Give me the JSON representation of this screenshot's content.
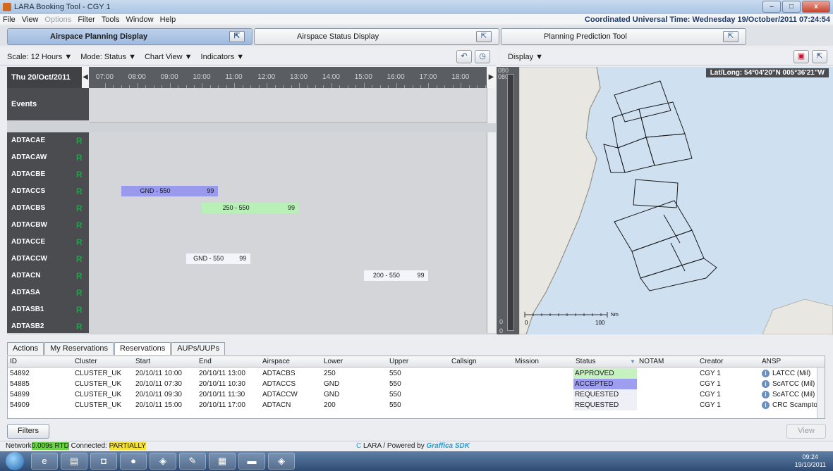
{
  "window": {
    "title": "LARA Booking Tool - CGY 1",
    "minimize": "–",
    "maximize": "□",
    "close": "x"
  },
  "menu": {
    "items": [
      {
        "label": "File",
        "disabled": false
      },
      {
        "label": "View",
        "disabled": false
      },
      {
        "label": "Options",
        "disabled": true
      },
      {
        "label": "Filter",
        "disabled": false
      },
      {
        "label": "Tools",
        "disabled": false
      },
      {
        "label": "Window",
        "disabled": false
      },
      {
        "label": "Help",
        "disabled": false
      }
    ],
    "utc_text": "Coordinated Universal Time: Wednesday 19/October/2011  07:24:54"
  },
  "tabs": [
    {
      "label": "Airspace Planning Display",
      "active": true
    },
    {
      "label": "Airspace Status Display",
      "active": false
    },
    {
      "label": "Planning Prediction Tool",
      "active": false
    }
  ],
  "tab_button_glyph": "⇱",
  "toolbar": {
    "scale": "Scale: 12 Hours ▼",
    "mode": "Mode: Status ▼",
    "chart_view": "Chart View ▼",
    "indicators": "Indicators ▼",
    "display": "Display ▼",
    "undo_glyph": "↶",
    "clock_glyph": "◷",
    "flag_glyph": "▣",
    "detach_glyph": "⇱"
  },
  "timeline": {
    "date": "Thu 20/Oct/2011",
    "left_arrow": "◀",
    "right_arrow": "▶",
    "hours": [
      "07:00",
      "08:00",
      "09:00",
      "10:00",
      "11:00",
      "12:00",
      "13:00",
      "14:00",
      "15:00",
      "16:00",
      "17:00",
      "18:00"
    ],
    "start_hour": 6.5,
    "end_hour": 18.8,
    "events_label": "Events",
    "rows": [
      {
        "name": "ADTACAE",
        "status": "R"
      },
      {
        "name": "ADTACAW",
        "status": "R"
      },
      {
        "name": "ADTACBE",
        "status": "R"
      },
      {
        "name": "ADTACCS",
        "status": "R",
        "bar": {
          "start": 7.5,
          "end": 10.5,
          "text": "GND - 550",
          "num": "99",
          "color": "#9999ee"
        }
      },
      {
        "name": "ADTACBS",
        "status": "R",
        "bar": {
          "start": 10.0,
          "end": 13.0,
          "text": "250 - 550",
          "num": "99",
          "color": "#b8f0b8"
        }
      },
      {
        "name": "ADTACBW",
        "status": "R"
      },
      {
        "name": "ADTACCE",
        "status": "R"
      },
      {
        "name": "ADTACCW",
        "status": "R",
        "bar": {
          "start": 9.5,
          "end": 11.5,
          "text": "GND - 550",
          "num": "99",
          "color": "#f4f4fb"
        }
      },
      {
        "name": "ADTACN",
        "status": "R",
        "bar": {
          "start": 15.0,
          "end": 17.0,
          "text": "200 - 550",
          "num": "99",
          "color": "#f4f4fb"
        }
      },
      {
        "name": "ADTASA",
        "status": "R"
      },
      {
        "name": "ADTASB1",
        "status": "R"
      },
      {
        "name": "ADTASB2",
        "status": "R"
      }
    ]
  },
  "levels": {
    "top1": "080",
    "top2": "080",
    "bottom1": "0",
    "bottom2": "0"
  },
  "map": {
    "latlong": "Lat/Long:  54°04'20\"N 005°36'21\"W",
    "scale_start": "0",
    "scale_end": "100",
    "scale_unit": "Nm"
  },
  "lower_tabs": [
    {
      "label": "Actions",
      "active": false
    },
    {
      "label": "My Reservations",
      "active": false
    },
    {
      "label": "Reservations",
      "active": true
    },
    {
      "label": "AUPs/UUPs",
      "active": false
    }
  ],
  "grid": {
    "columns": [
      "ID",
      "Cluster",
      "Start",
      "End",
      "Airspace",
      "Lower",
      "Upper",
      "Callsign",
      "Mission",
      "Status",
      "NOTAM",
      "Creator",
      "ANSP"
    ],
    "sort_glyph": "▼",
    "rows": [
      {
        "id": "54892",
        "cluster": "CLUSTER_UK",
        "start": "20/10/11 10:00",
        "end": "20/10/11 13:00",
        "airspace": "ADTACBS",
        "lower": "250",
        "upper": "550",
        "callsign": "",
        "mission": "",
        "status": "APPROVED",
        "status_color": "#c6f2c0",
        "notam": "",
        "creator": "CGY 1",
        "ansp": "LATCC (Mil)"
      },
      {
        "id": "54885",
        "cluster": "CLUSTER_UK",
        "start": "20/10/11 07:30",
        "end": "20/10/11 10:30",
        "airspace": "ADTACCS",
        "lower": "GND",
        "upper": "550",
        "callsign": "",
        "mission": "",
        "status": "ACCEPTED",
        "status_color": "#9d9df2",
        "notam": "",
        "creator": "CGY 1",
        "ansp": "ScATCC (Mil)"
      },
      {
        "id": "54899",
        "cluster": "CLUSTER_UK",
        "start": "20/10/11 09:30",
        "end": "20/10/11 11:30",
        "airspace": "ADTACCW",
        "lower": "GND",
        "upper": "550",
        "callsign": "",
        "mission": "",
        "status": "REQUESTED",
        "status_color": "#efeff7",
        "notam": "",
        "creator": "CGY 1",
        "ansp": "ScATCC (Mil)"
      },
      {
        "id": "54909",
        "cluster": "CLUSTER_UK",
        "start": "20/10/11 15:00",
        "end": "20/10/11 17:00",
        "airspace": "ADTACN",
        "lower": "200",
        "upper": "550",
        "callsign": "",
        "mission": "",
        "status": "REQUESTED",
        "status_color": "#efeff7",
        "notam": "",
        "creator": "CGY 1",
        "ansp": "CRC Scampton"
      }
    ]
  },
  "buttons": {
    "filters": "Filters",
    "view": "View"
  },
  "statusbar": {
    "network": "Network",
    "rtd": "0.009s RTD",
    "connected": " Connected: ",
    "partially": "PARTIALLY",
    "powered_prefix": "LARA  /  Powered by ",
    "brand": "Graffica SDK"
  },
  "taskbar": {
    "time": "09:24",
    "date": "19/10/2011"
  }
}
